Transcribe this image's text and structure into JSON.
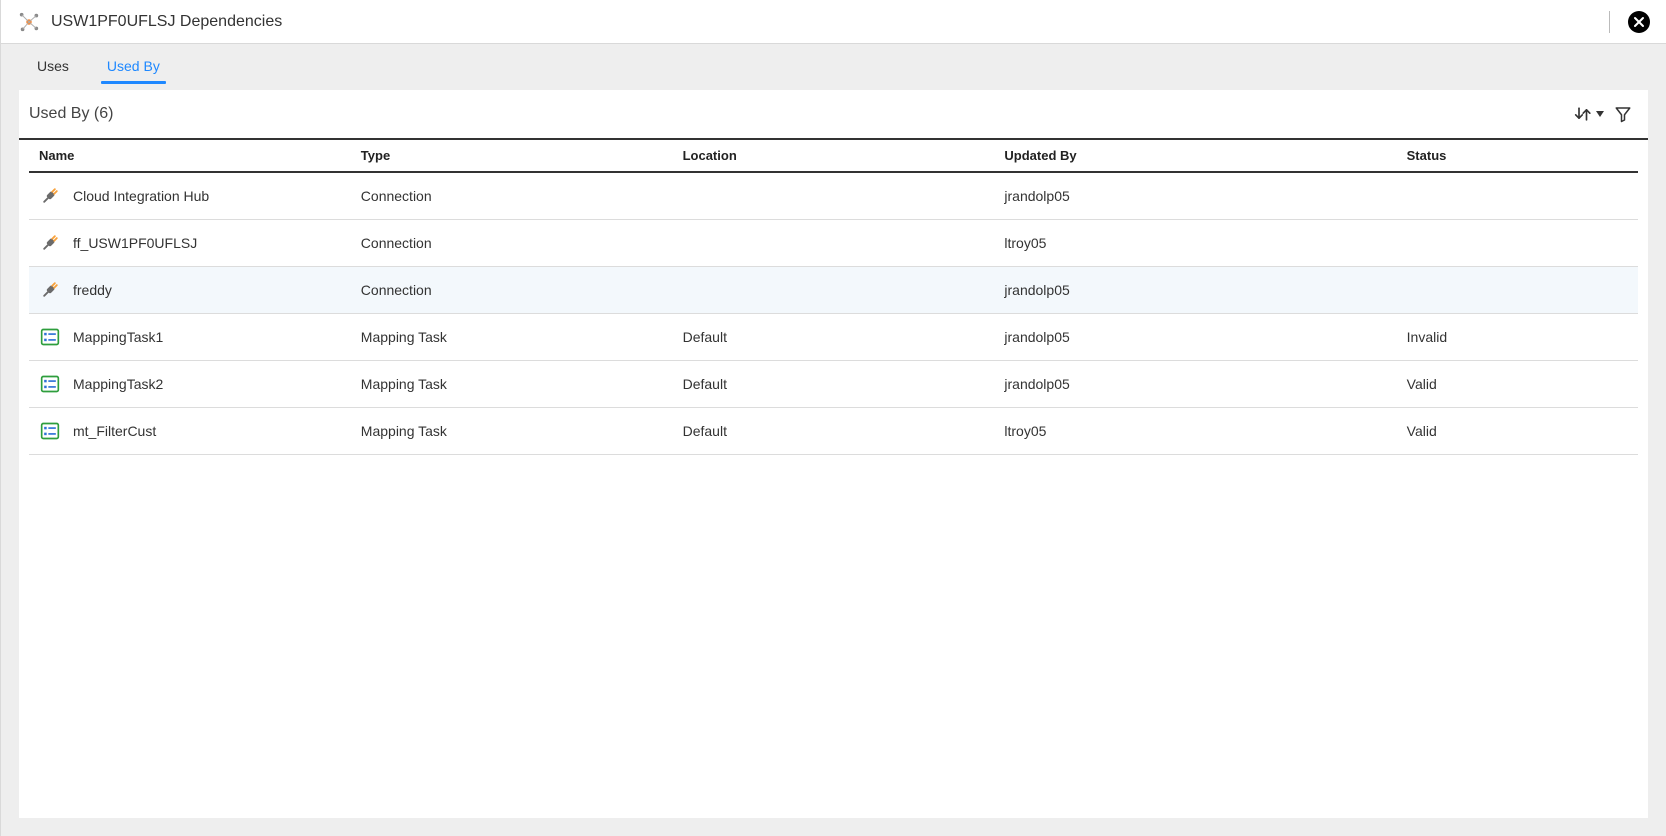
{
  "header": {
    "title": "USW1PF0UFLSJ Dependencies"
  },
  "tabs": [
    {
      "id": "uses",
      "label": "Uses",
      "active": false
    },
    {
      "id": "used-by",
      "label": "Used By",
      "active": true
    }
  ],
  "panel": {
    "title": "Used By (6)"
  },
  "columns": {
    "name": "Name",
    "type": "Type",
    "location": "Location",
    "updated_by": "Updated By",
    "status": "Status"
  },
  "rows": [
    {
      "icon": "connection",
      "name": "Cloud Integration Hub",
      "type": "Connection",
      "location": "",
      "updated_by": "jrandolp05",
      "status": "",
      "highlight": false
    },
    {
      "icon": "connection",
      "name": "ff_USW1PF0UFLSJ",
      "type": "Connection",
      "location": "",
      "updated_by": "ltroy05",
      "status": "",
      "highlight": false
    },
    {
      "icon": "connection",
      "name": "freddy",
      "type": "Connection",
      "location": "",
      "updated_by": "jrandolp05",
      "status": "",
      "highlight": true
    },
    {
      "icon": "mapping",
      "name": "MappingTask1",
      "type": "Mapping Task",
      "location": "Default",
      "updated_by": "jrandolp05",
      "status": "Invalid",
      "highlight": false
    },
    {
      "icon": "mapping",
      "name": "MappingTask2",
      "type": "Mapping Task",
      "location": "Default",
      "updated_by": "jrandolp05",
      "status": "Valid",
      "highlight": false
    },
    {
      "icon": "mapping",
      "name": "mt_FilterCust",
      "type": "Mapping Task",
      "location": "Default",
      "updated_by": "ltroy05",
      "status": "Valid",
      "highlight": false
    }
  ]
}
